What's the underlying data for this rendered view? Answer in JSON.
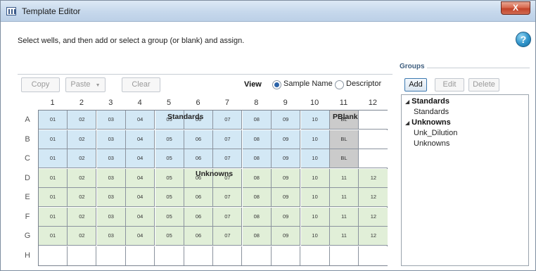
{
  "window": {
    "title": "Template Editor",
    "close_label": "X"
  },
  "instructions": "Select wells, and then add or select a group (or blank) and assign.",
  "help_label": "?",
  "toolbar": {
    "copy": "Copy",
    "paste": "Paste",
    "paste_arrow": "▼",
    "clear": "Clear"
  },
  "view": {
    "label": "View",
    "options": [
      "Sample Name",
      "Descriptor"
    ],
    "selected": "Sample Name"
  },
  "plate": {
    "columns": [
      "1",
      "2",
      "3",
      "4",
      "5",
      "6",
      "7",
      "8",
      "9",
      "10",
      "11",
      "12"
    ],
    "rows": [
      "A",
      "B",
      "C",
      "D",
      "E",
      "F",
      "G",
      "H"
    ],
    "wells": [
      [
        "01",
        "02",
        "03",
        "04",
        "05",
        "06",
        "07",
        "08",
        "09",
        "10",
        "BL",
        ""
      ],
      [
        "01",
        "02",
        "03",
        "04",
        "05",
        "06",
        "07",
        "08",
        "09",
        "10",
        "BL",
        ""
      ],
      [
        "01",
        "02",
        "03",
        "04",
        "05",
        "06",
        "07",
        "08",
        "09",
        "10",
        "BL",
        ""
      ],
      [
        "01",
        "02",
        "03",
        "04",
        "05",
        "06",
        "07",
        "08",
        "09",
        "10",
        "11",
        "12"
      ],
      [
        "01",
        "02",
        "03",
        "04",
        "05",
        "06",
        "07",
        "08",
        "09",
        "10",
        "11",
        "12"
      ],
      [
        "01",
        "02",
        "03",
        "04",
        "05",
        "06",
        "07",
        "08",
        "09",
        "10",
        "11",
        "12"
      ],
      [
        "01",
        "02",
        "03",
        "04",
        "05",
        "06",
        "07",
        "08",
        "09",
        "10",
        "11",
        "12"
      ],
      [
        "",
        "",
        "",
        "",
        "",
        "",
        "",
        "",
        "",
        "",
        "",
        ""
      ]
    ],
    "group_labels": {
      "standards": "Standards",
      "blank": "PBlank",
      "unknowns": "Unknowns"
    }
  },
  "groups": {
    "header": "Groups",
    "buttons": {
      "add": "Add",
      "edit": "Edit",
      "delete": "Delete"
    },
    "tree": [
      {
        "name": "Standards",
        "children": [
          "Standards"
        ]
      },
      {
        "name": "Unknowns",
        "children": [
          "Unk_Dilution",
          "Unknowns"
        ]
      }
    ]
  },
  "colors": {
    "standard": "#d3e8f5",
    "unknown": "#e1efd8",
    "blank": "#cbcbcb",
    "accent": "#2b63a8"
  }
}
